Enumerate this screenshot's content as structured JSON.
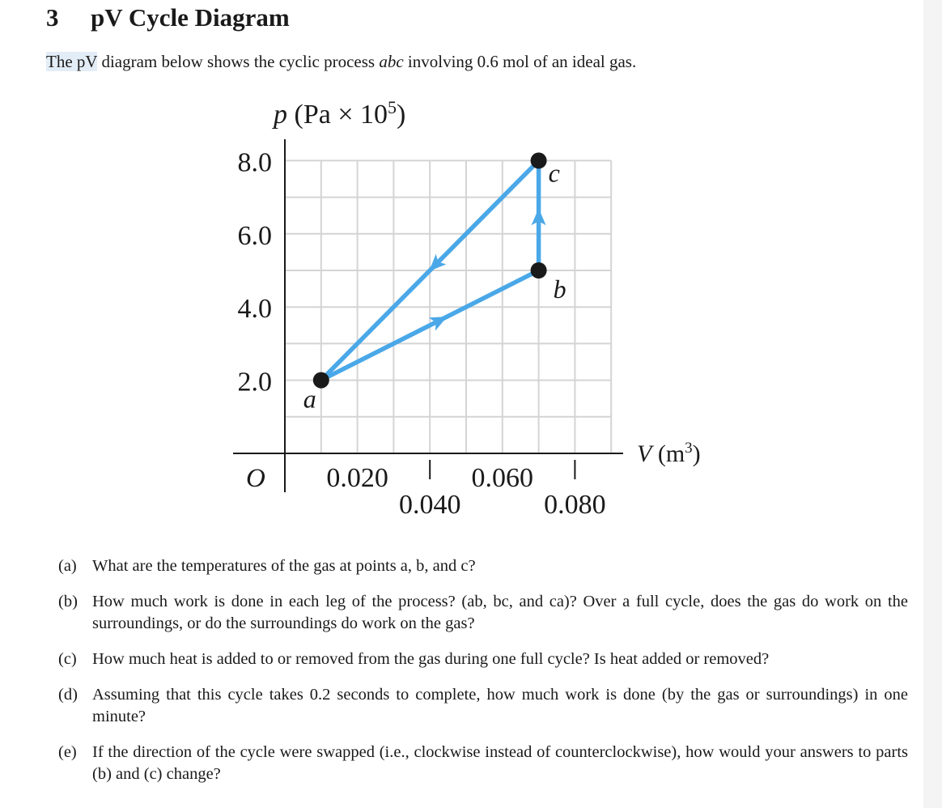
{
  "section": {
    "number": "3",
    "title": "pV Cycle Diagram"
  },
  "intro": {
    "highlighted": "The pV",
    "text_before_italic": " diagram below shows the cyclic process ",
    "italic": "abc",
    "text_after_italic": " involving 0.6 mol of an ideal gas."
  },
  "chart_data": {
    "type": "line",
    "title": "",
    "xlabel": "V (m³)",
    "ylabel": "p (Pa × 10⁵)",
    "xlim": [
      0,
      0.09
    ],
    "ylim": [
      0,
      9.0
    ],
    "origin_label": "O",
    "grid": true,
    "grid_step_x": 0.01,
    "grid_step_y": 1.0,
    "x_ticks": [
      {
        "value": 0.02,
        "label": "0.020",
        "row": "upper"
      },
      {
        "value": 0.04,
        "label": "0.040",
        "row": "lower"
      },
      {
        "value": 0.06,
        "label": "0.060",
        "row": "upper"
      },
      {
        "value": 0.08,
        "label": "0.080",
        "row": "lower"
      }
    ],
    "y_ticks": [
      {
        "value": 2.0,
        "label": "2.0"
      },
      {
        "value": 4.0,
        "label": "4.0"
      },
      {
        "value": 6.0,
        "label": "6.0"
      },
      {
        "value": 8.0,
        "label": "8.0"
      }
    ],
    "points": [
      {
        "name": "a",
        "V": 0.01,
        "p": 2.0
      },
      {
        "name": "b",
        "V": 0.07,
        "p": 5.0
      },
      {
        "name": "c",
        "V": 0.07,
        "p": 8.0
      }
    ],
    "path": [
      {
        "from": "a",
        "to": "b",
        "direction": "a→b"
      },
      {
        "from": "b",
        "to": "c",
        "direction": "b→c"
      },
      {
        "from": "c",
        "to": "a",
        "direction": "c→a"
      }
    ],
    "colors": {
      "path": "#4aa8e8",
      "points": "#1a1a1a",
      "grid": "#d4d4d4",
      "axis": "#1a1a1a"
    }
  },
  "questions": [
    {
      "label": "(a)",
      "text": "What are the temperatures of the gas at points a, b, and c?"
    },
    {
      "label": "(b)",
      "text": "How much work is done in each leg of the process? (ab, bc, and ca)? Over a full cycle, does the gas do work on the surroundings, or do the surroundings do work on the gas?"
    },
    {
      "label": "(c)",
      "text": "How much heat is added to or removed from the gas during one full cycle? Is heat added or removed?"
    },
    {
      "label": "(d)",
      "text": "Assuming that this cycle takes 0.2 seconds to complete, how much work is done (by the gas or surroundings) in one minute?"
    },
    {
      "label": "(e)",
      "text": "If the direction of the cycle were swapped (i.e., clockwise instead of counterclockwise), how would your answers to parts (b) and (c) change?"
    }
  ]
}
